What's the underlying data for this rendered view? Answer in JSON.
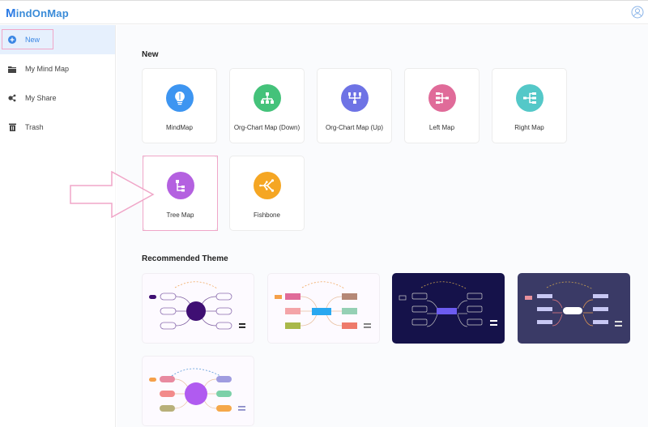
{
  "app": {
    "logo_text": "indOnMap",
    "logo_mark": "M"
  },
  "header": {
    "user_icon": "user-circle-icon"
  },
  "sidebar": {
    "items": [
      {
        "label": "New",
        "icon": "plus-circle-icon",
        "active": true
      },
      {
        "label": "My Mind Map",
        "icon": "folder-icon",
        "active": false
      },
      {
        "label": "My Share",
        "icon": "share-icon",
        "active": false
      },
      {
        "label": "Trash",
        "icon": "trash-icon",
        "active": false
      }
    ]
  },
  "main": {
    "new_title": "New",
    "templates": [
      {
        "label": "MindMap",
        "icon": "lightbulb-icon",
        "color": "#3d95f1"
      },
      {
        "label": "Org-Chart Map (Down)",
        "icon": "org-chart-down-icon",
        "color": "#44c27a"
      },
      {
        "label": "Org-Chart Map (Up)",
        "icon": "org-chart-up-icon",
        "color": "#6e73e5"
      },
      {
        "label": "Left Map",
        "icon": "left-map-icon",
        "color": "#e06b99"
      },
      {
        "label": "Right Map",
        "icon": "right-map-icon",
        "color": "#54c8c8"
      },
      {
        "label": "Tree Map",
        "icon": "tree-map-icon",
        "color": "#b461e0"
      },
      {
        "label": "Fishbone",
        "icon": "fishbone-icon",
        "color": "#f5a623"
      }
    ],
    "theme_title": "Recommended Theme",
    "themes": [
      {
        "name": "theme-purple-outline",
        "bg": "#fdfaff",
        "center": "#3f0f73"
      },
      {
        "name": "theme-colorful",
        "bg": "#fdfaff",
        "center": "#29a8f0"
      },
      {
        "name": "theme-dark-navy",
        "bg": "#15124a",
        "center": "#6c5cf0"
      },
      {
        "name": "theme-slate",
        "bg": "#3a3a66",
        "center": "#ffffff"
      },
      {
        "name": "theme-pastel",
        "bg": "#fdfaff",
        "center": "#b05bf0"
      }
    ]
  },
  "colors": {
    "accent": "#3a86e4",
    "highlight": "#f0a6c8"
  }
}
